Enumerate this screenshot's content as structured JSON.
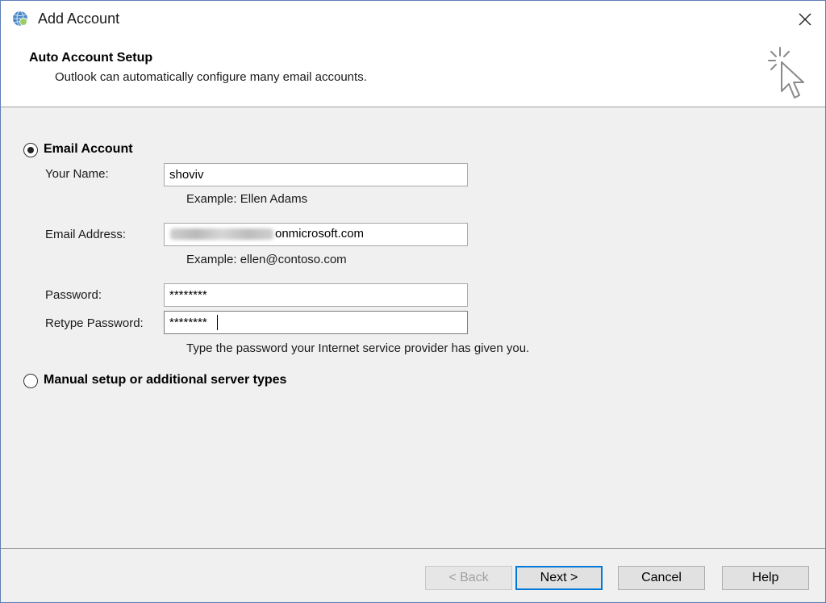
{
  "window": {
    "title": "Add Account",
    "icon": "outlook-globe-icon",
    "close_icon": "close-icon"
  },
  "header": {
    "title": "Auto Account Setup",
    "subtitle": "Outlook can automatically configure many email accounts.",
    "art_icon": "cursor-click-icon"
  },
  "options": {
    "email_account": {
      "label": "Email Account",
      "selected": true
    },
    "manual_setup": {
      "label": "Manual setup or additional server types",
      "selected": false
    }
  },
  "form": {
    "name": {
      "label": "Your Name:",
      "value": "shoviv",
      "hint": "Example: Ellen Adams"
    },
    "email": {
      "label": "Email Address:",
      "value_visible": "onmicrosoft.com",
      "hint": "Example: ellen@contoso.com"
    },
    "password": {
      "label": "Password:",
      "value": "********"
    },
    "retype": {
      "label": "Retype Password:",
      "value": "********"
    },
    "password_hint": "Type the password your Internet service provider has given you."
  },
  "buttons": {
    "back": "< Back",
    "next": "Next >",
    "cancel": "Cancel",
    "help": "Help"
  },
  "colors": {
    "accent": "#0078d7",
    "window_border": "#5b7fb6",
    "body_bg": "#f0f0f0"
  }
}
